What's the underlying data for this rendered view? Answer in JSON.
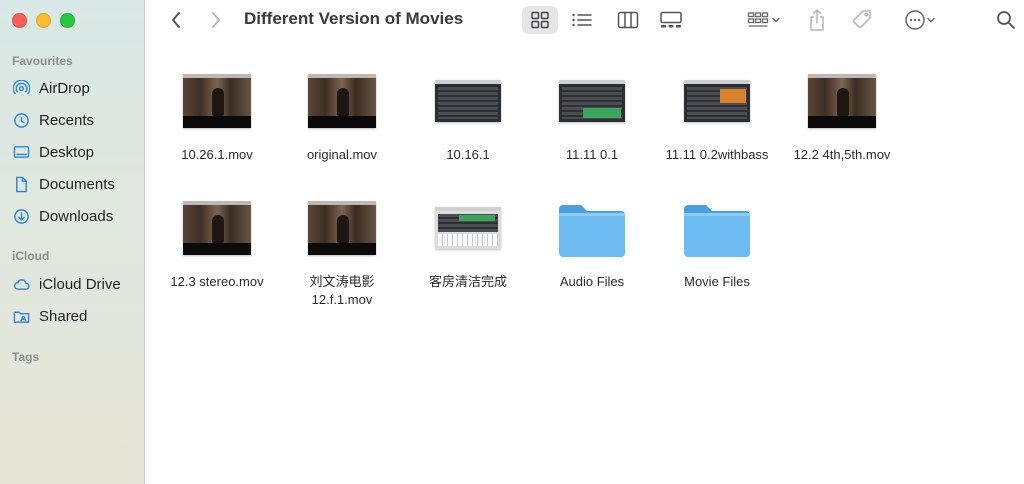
{
  "window": {
    "title": "Different Version of Movies"
  },
  "sidebar": {
    "sections": [
      {
        "title": "Favourites",
        "items": [
          {
            "label": "AirDrop",
            "icon": "airdrop-icon"
          },
          {
            "label": "Recents",
            "icon": "clock-icon"
          },
          {
            "label": "Desktop",
            "icon": "desktop-icon"
          },
          {
            "label": "Documents",
            "icon": "document-icon"
          },
          {
            "label": "Downloads",
            "icon": "download-icon"
          }
        ]
      },
      {
        "title": "iCloud",
        "items": [
          {
            "label": "iCloud Drive",
            "icon": "cloud-icon"
          },
          {
            "label": "Shared",
            "icon": "shared-folder-icon"
          }
        ]
      },
      {
        "title": "Tags",
        "items": []
      }
    ]
  },
  "toolbar": {
    "back": "chevron-left-icon",
    "forward": "chevron-right-icon",
    "views": [
      "icon-view",
      "list-view",
      "column-view",
      "gallery-view"
    ],
    "selected_view": "icon-view"
  },
  "files": [
    {
      "name": "10.26.1.mov",
      "kind": "movie"
    },
    {
      "name": "original.mov",
      "kind": "movie"
    },
    {
      "name": "10.16.1",
      "kind": "logic-project"
    },
    {
      "name": "11.11 0.1",
      "kind": "logic-project"
    },
    {
      "name": "11.11 0.2withbass",
      "kind": "logic-project"
    },
    {
      "name": "12.2 4th,5th.mov",
      "kind": "movie"
    },
    {
      "name": "12.3 stereo.mov",
      "kind": "movie"
    },
    {
      "name": "刘文涛电影\n12.f.1.mov",
      "line1": "刘文涛电影",
      "line2": "12.f.1.mov",
      "kind": "movie"
    },
    {
      "name": "客房清洁完成",
      "kind": "logic-project"
    },
    {
      "name": "Audio Files",
      "kind": "folder"
    },
    {
      "name": "Movie Files",
      "kind": "folder"
    }
  ],
  "colors": {
    "folder": "#5eb0ea",
    "accent_green": "#3aa55c",
    "accent_orange": "#d9822b"
  }
}
